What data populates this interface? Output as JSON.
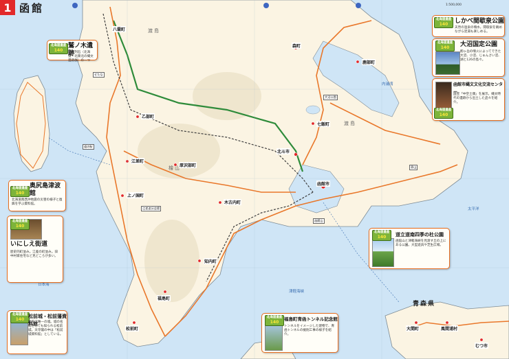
{
  "header": {
    "number": "1",
    "title": "函館"
  },
  "scale_text": "1:500,000",
  "cards": {
    "washinoki": {
      "title": "鷲ノ木遺跡",
      "desc": "環状列石（北海道・北東北の縄文遺跡群）の一つ",
      "badge_top": "北海道遺産",
      "badge_num": "140"
    },
    "okushiri": {
      "title": "奥尻島津波館",
      "desc": "北海道南西沖地震の災害の様子と復興を学ぶ資料館。",
      "badge_top": "北海道遺産",
      "badge_num": "140"
    },
    "inishie": {
      "title": "いにしえ街道",
      "desc": "歴史的町並み。江差の町並み。旧中村家住宅など見どころが多い。",
      "badge_top": "北海道遺産",
      "badge_num": "140"
    },
    "matsumae": {
      "title": "松前城・松前藩資料館",
      "desc": "国内で唯一の城。城の名前としても知られる松前城。天守閣の中は「松前城資料館」としている。",
      "badge_top": "北海道遺産",
      "badge_num": "140"
    },
    "seikan": {
      "title": "福島町青函トンネル記念館",
      "desc": "トンネルをイメージした建物で、青函トンネルの掘削工事の様子を紹介。",
      "badge_top": "北海道遺産",
      "badge_num": "140"
    },
    "shikabe": {
      "title": "しかべ間歇泉公園",
      "desc": "天然の温泉の噴水。間歇泉を眺めながら足湯も楽しめる。",
      "badge_top": "北海道遺産",
      "badge_num": "140"
    },
    "onuma": {
      "title": "大沼国定公園",
      "desc": "駒ヶ岳の噴火によってできた大沼、小沼、じゅんさい沼、湖と126の島々。",
      "badge_top": "北海道遺産",
      "badge_num": "140"
    },
    "jomon": {
      "title": "函館市縄文文化交流センター",
      "desc": "国宝「中空土偶」を展示。縄文時代の遺跡から出土した品々を紹介。",
      "badge_top": "北海道遺産",
      "badge_num": "140"
    },
    "nanbu": {
      "title": "道立道南四季の杜公園",
      "desc": "函館山と津軽海峡を見渡す丘の上にある公園。大型遊具や芝生広場。",
      "badge_top": "北海道遺産",
      "badge_num": "140"
    }
  },
  "regions": [
    "渡島",
    "檜山",
    "渡島"
  ],
  "cities": [
    "八雲町",
    "森町",
    "北斗市",
    "函館市",
    "上ノ国町",
    "江差町",
    "木古内町",
    "知内町",
    "福島町",
    "松前町",
    "大間町",
    "風間浦村",
    "むつ市",
    "乙部町",
    "厚沢部町",
    "七飯町",
    "鹿部町"
  ],
  "seas": [
    "日本海",
    "津軽海峡",
    "太平洋",
    "内浦湾"
  ],
  "prefecture": "青森県",
  "notes": [
    "せたな",
    "道の駅",
    "江差追分会館",
    "函館山",
    "恵山",
    "大沼公園"
  ],
  "colors": {
    "land": "#fbf4e3",
    "sea": "#cfe5f6",
    "road": "#e9772a",
    "highway": "#2e8b3a",
    "rail": "#3d3d3d",
    "accent": "#e2292a",
    "card_border": "#e66c1e"
  }
}
